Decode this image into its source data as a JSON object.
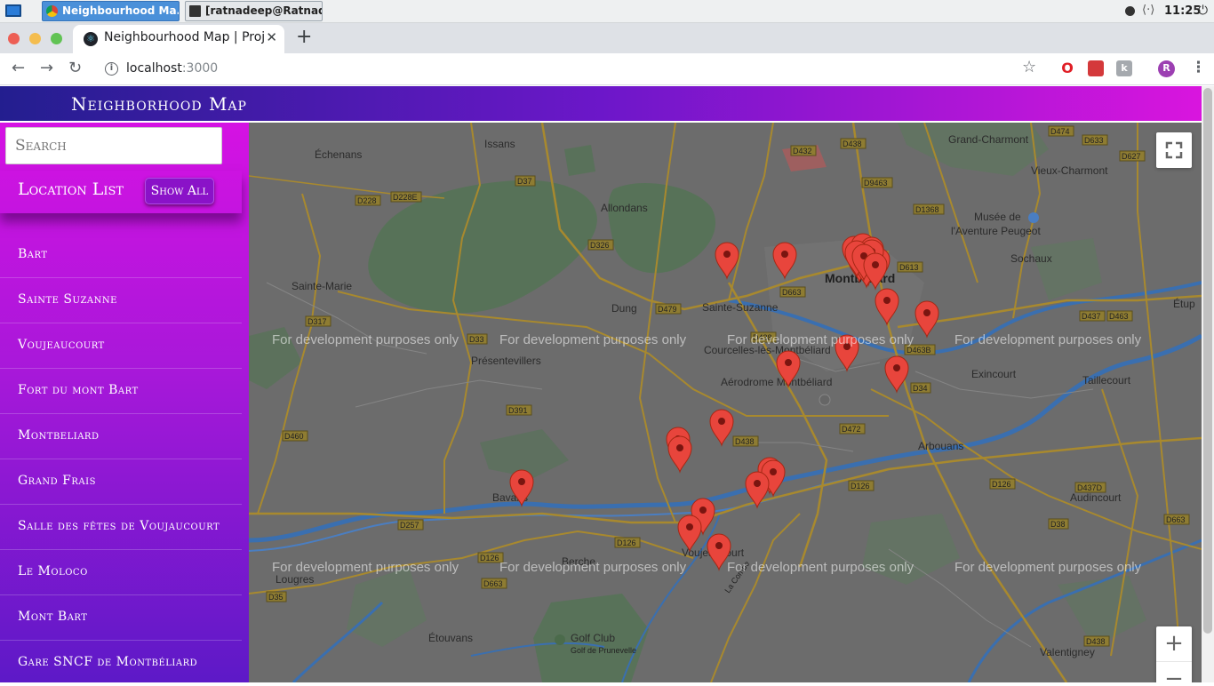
{
  "taskbar": {
    "tasks": [
      "Neighbourhood Ma...",
      "[ratnadeep@Ratnad..."
    ],
    "time": "11:25"
  },
  "browser": {
    "tab_title": "Neighbourhood Map | Proje",
    "url_host": "localhost",
    "url_port": ":3000",
    "avatar_letter": "R"
  },
  "app": {
    "title": "Neighborhood Map",
    "search_placeholder": "Search",
    "list_title": "Location List",
    "show_all": "Show All",
    "locations": [
      "Bart",
      "Sainte Suzanne",
      "Voujeaucourt",
      "Fort du mont Bart",
      "Montbeliard",
      "Grand Frais",
      "Salle des fêtes de Voujaucourt",
      "Le Moloco",
      "Mont Bart",
      "Gare SNCF de Montbéliard"
    ]
  },
  "map": {
    "dev_watermark": "For development purposes only",
    "place_labels": {
      "issans": "Issans",
      "echenans": "Échenans",
      "allondans": "Allondans",
      "sainte_marie": "Sainte-Marie",
      "dung": "Dung",
      "sainte_suzanne": "Sainte-Suzanne",
      "montbeliard": "Montbéliard",
      "presentevillers": "Présentevillers",
      "courcelles": "Courcelles-lès-Montbéliard",
      "aerodrome": "Aérodrome Montbéliard",
      "grand_charmont": "Grand-Charmont",
      "vieux_charmont": "Vieux-Charmont",
      "musee1": "Musée de",
      "musee2": "l'Aventure Peugeot",
      "sochaux": "Sochaux",
      "exincourt": "Exincourt",
      "taillecourt": "Taillecourt",
      "arbouans": "Arbouans",
      "audincourt": "Audincourt",
      "etupes": "Étup",
      "bavans": "Bavans",
      "voujeaucourt": "Voujeaucourt",
      "berche": "Berche",
      "lougres": "Lougres",
      "etouvans": "Étouvans",
      "golf1": "Golf Club",
      "golf2": "Golf de Prunevelle",
      "valentigney": "Valentigney",
      "la_combe": "La Combe"
    },
    "road_labels": [
      "D432",
      "D438",
      "D9463",
      "D1368",
      "D474",
      "D633",
      "D627",
      "D37",
      "D228",
      "D228E",
      "D326",
      "D479",
      "D663",
      "D613",
      "D437",
      "D463",
      "D33",
      "D317",
      "D438",
      "D463B",
      "D34",
      "D391",
      "D460",
      "D438",
      "D472",
      "D126",
      "D437D",
      "D38",
      "D126",
      "D663",
      "D126",
      "D257",
      "D126",
      "D663",
      "D35",
      "D438"
    ],
    "controls": {
      "zoom_in": "+",
      "zoom_out": "−"
    },
    "marker_count": 28
  },
  "colors": {
    "accent_start": "#231e8f",
    "accent_end": "#d915de",
    "marker": "#e8453c"
  }
}
